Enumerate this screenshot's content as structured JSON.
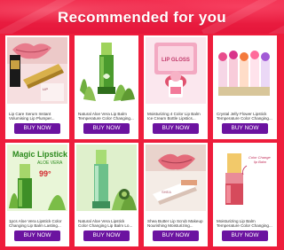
{
  "header": {
    "title": "Recommended for you"
  },
  "products": [
    {
      "name": "Lip Care Serum Instant Volumising Lip Plumper...",
      "cta": "BUY NOW",
      "image_icon": "lip-plumper-product-photo"
    },
    {
      "name": "Natural Aloe Vera Lip Balm Temperature Color Changing...",
      "cta": "BUY NOW",
      "image_icon": "aloe-vera-lipstick-photo"
    },
    {
      "name": "Moisturizing 4 Color Lip Balm Ice Cream Bottle Lipstics...",
      "cta": "BUY NOW",
      "image_icon": "ice-cream-lip-balm-photo"
    },
    {
      "name": "Crystal Jelly Flower Lipstick Temperature Color Changing...",
      "cta": "BUY NOW",
      "image_icon": "jelly-flower-lipstick-photo"
    },
    {
      "name": "1pcs Aloe Vera Lipstick Color Changing Lip Balm Lasting...",
      "cta": "BUY NOW",
      "image_icon": "magic-lipstick-photo",
      "badge": "99°"
    },
    {
      "name": "Natural Aloe Vera Lipstick Color Changing Lip Balm Lo...",
      "cta": "BUY NOW",
      "image_icon": "green-lipstick-photo"
    },
    {
      "name": "Shea Butter Lip Scrub Makeup Nourishing Moisturizing...",
      "cta": "BUY NOW",
      "image_icon": "lip-scrub-photo"
    },
    {
      "name": "Moisturizing Lip Balm Temperature Color Changing...",
      "cta": "BUY NOW",
      "image_icon": "color-change-lip-balm-photo",
      "badge": "Color Change\nlip Balm"
    }
  ],
  "images": {
    "p5_heading": "Magic Lipstick",
    "p5_sub": "ALOE VERA",
    "p3_label": "LIP GLOSS",
    "p8_caption": "Color Change lip Balm"
  },
  "colors": {
    "background": "#ee1d3c",
    "card": "#ffffff",
    "button": "#6b13a0",
    "button_text": "#ffffff"
  }
}
